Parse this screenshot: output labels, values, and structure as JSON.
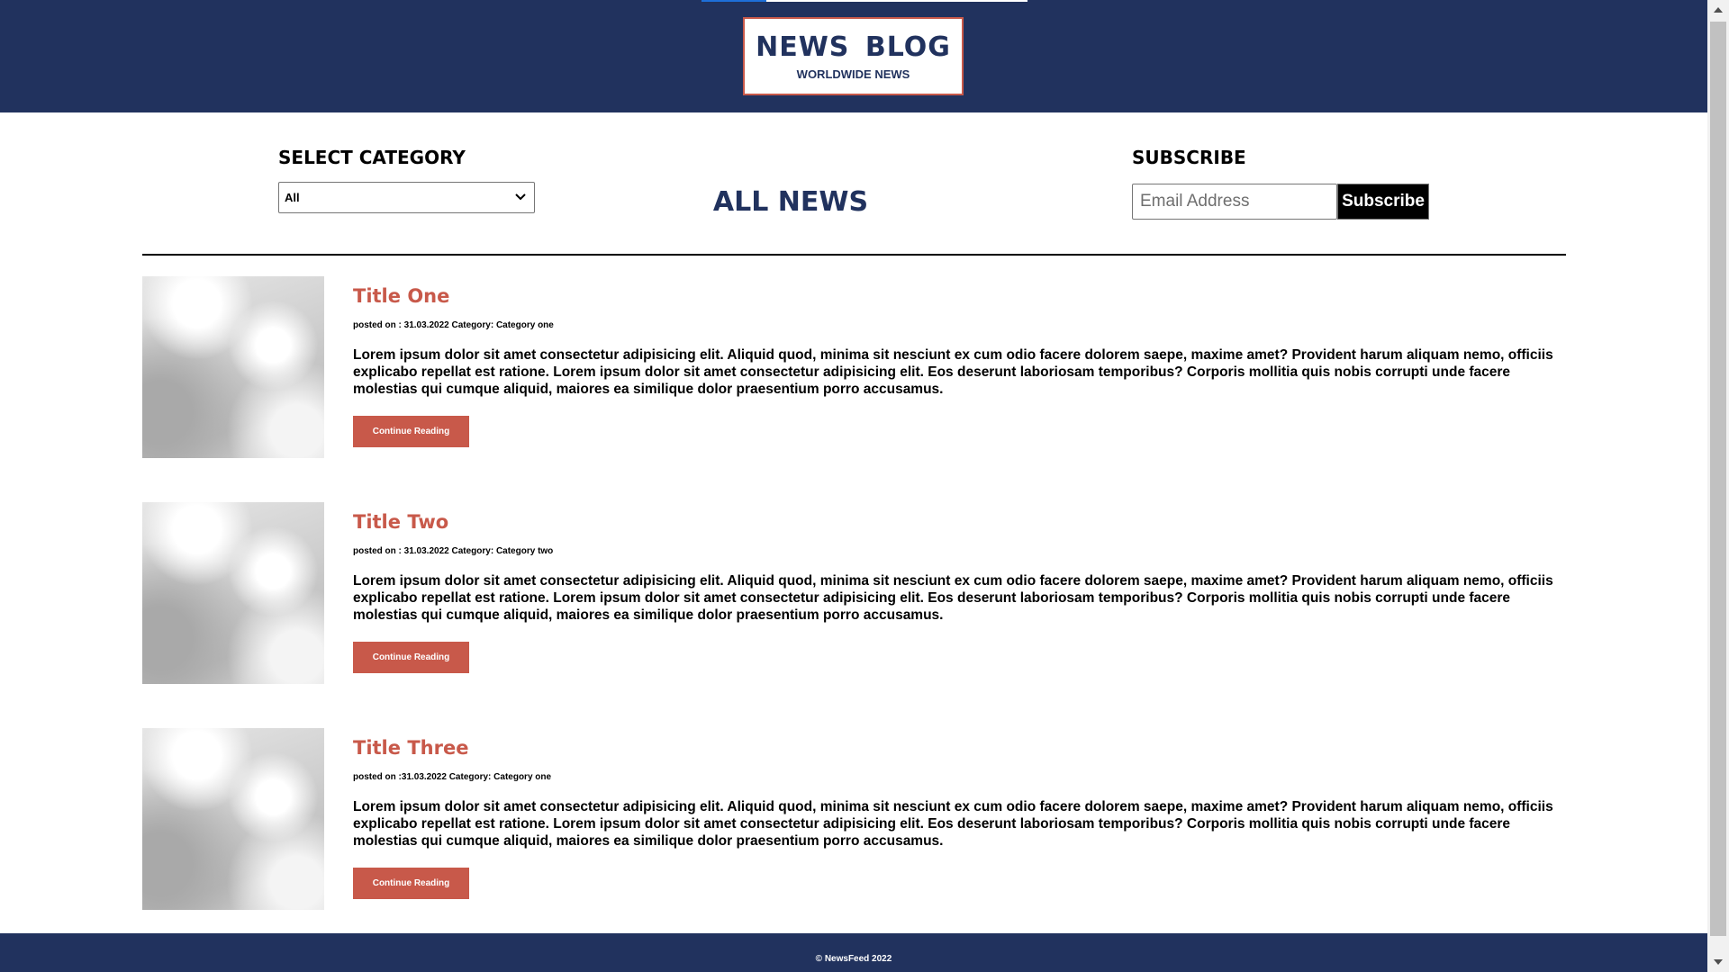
{
  "header": {
    "logo_title": "NEWS  BLOG",
    "logo_subtitle": "WORLDWIDE NEWS"
  },
  "category": {
    "label": "SELECT CATEGORY",
    "selected": "All"
  },
  "page_heading": "ALL NEWS",
  "subscribe": {
    "label": "SUBSCRIBE",
    "email_placeholder": "Email Address",
    "button_label": "Subscribe"
  },
  "articles": [
    {
      "title": "Title One",
      "meta": "posted on : 31.03.2022 Category: Category one",
      "body": "Lorem ipsum dolor sit amet consectetur adipisicing elit. Aliquid quod, minima sit nesciunt ex cum odio facere dolorem saepe, maxime amet? Provident harum aliquam nemo, officiis explicabo repellat est ratione. Lorem ipsum dolor sit amet consectetur adipisicing elit. Eos deserunt laboriosam temporibus? Corporis mollitia quis nobis corrupti unde facere molestias qui cumque aliquid, maiores ea similique dolor praesentium porro accusamus.",
      "button_label": "Continue Reading"
    },
    {
      "title": "Title Two",
      "meta": "posted on : 31.03.2022 Category: Category two",
      "body": "Lorem ipsum dolor sit amet consectetur adipisicing elit. Aliquid quod, minima sit nesciunt ex cum odio facere dolorem saepe, maxime amet? Provident harum aliquam nemo, officiis explicabo repellat est ratione. Lorem ipsum dolor sit amet consectetur adipisicing elit. Eos deserunt laboriosam temporibus? Corporis mollitia quis nobis corrupti unde facere molestias qui cumque aliquid, maiores ea similique dolor praesentium porro accusamus.",
      "button_label": "Continue Reading"
    },
    {
      "title": "Title Three",
      "meta": "posted on :31.03.2022 Category: Category one",
      "body": "Lorem ipsum dolor sit amet consectetur adipisicing elit. Aliquid quod, minima sit nesciunt ex cum odio facere dolorem saepe, maxime amet? Provident harum aliquam nemo, officiis explicabo repellat est ratione. Lorem ipsum dolor sit amet consectetur adipisicing elit. Eos deserunt laboriosam temporibus? Corporis mollitia quis nobis corrupti unde facere molestias qui cumque aliquid, maiores ea similique dolor praesentium porro accusamus.",
      "button_label": "Continue Reading"
    }
  ],
  "footer": {
    "text": "© NewsFeed 2022"
  },
  "colors": {
    "navy": "#21325e",
    "accent": "#c8594a",
    "loader": "#1e6fd9"
  },
  "icons": {
    "select": "chevron-down-icon",
    "scroll_up": "arrow-up-icon",
    "scroll_down": "arrow-down-icon"
  }
}
